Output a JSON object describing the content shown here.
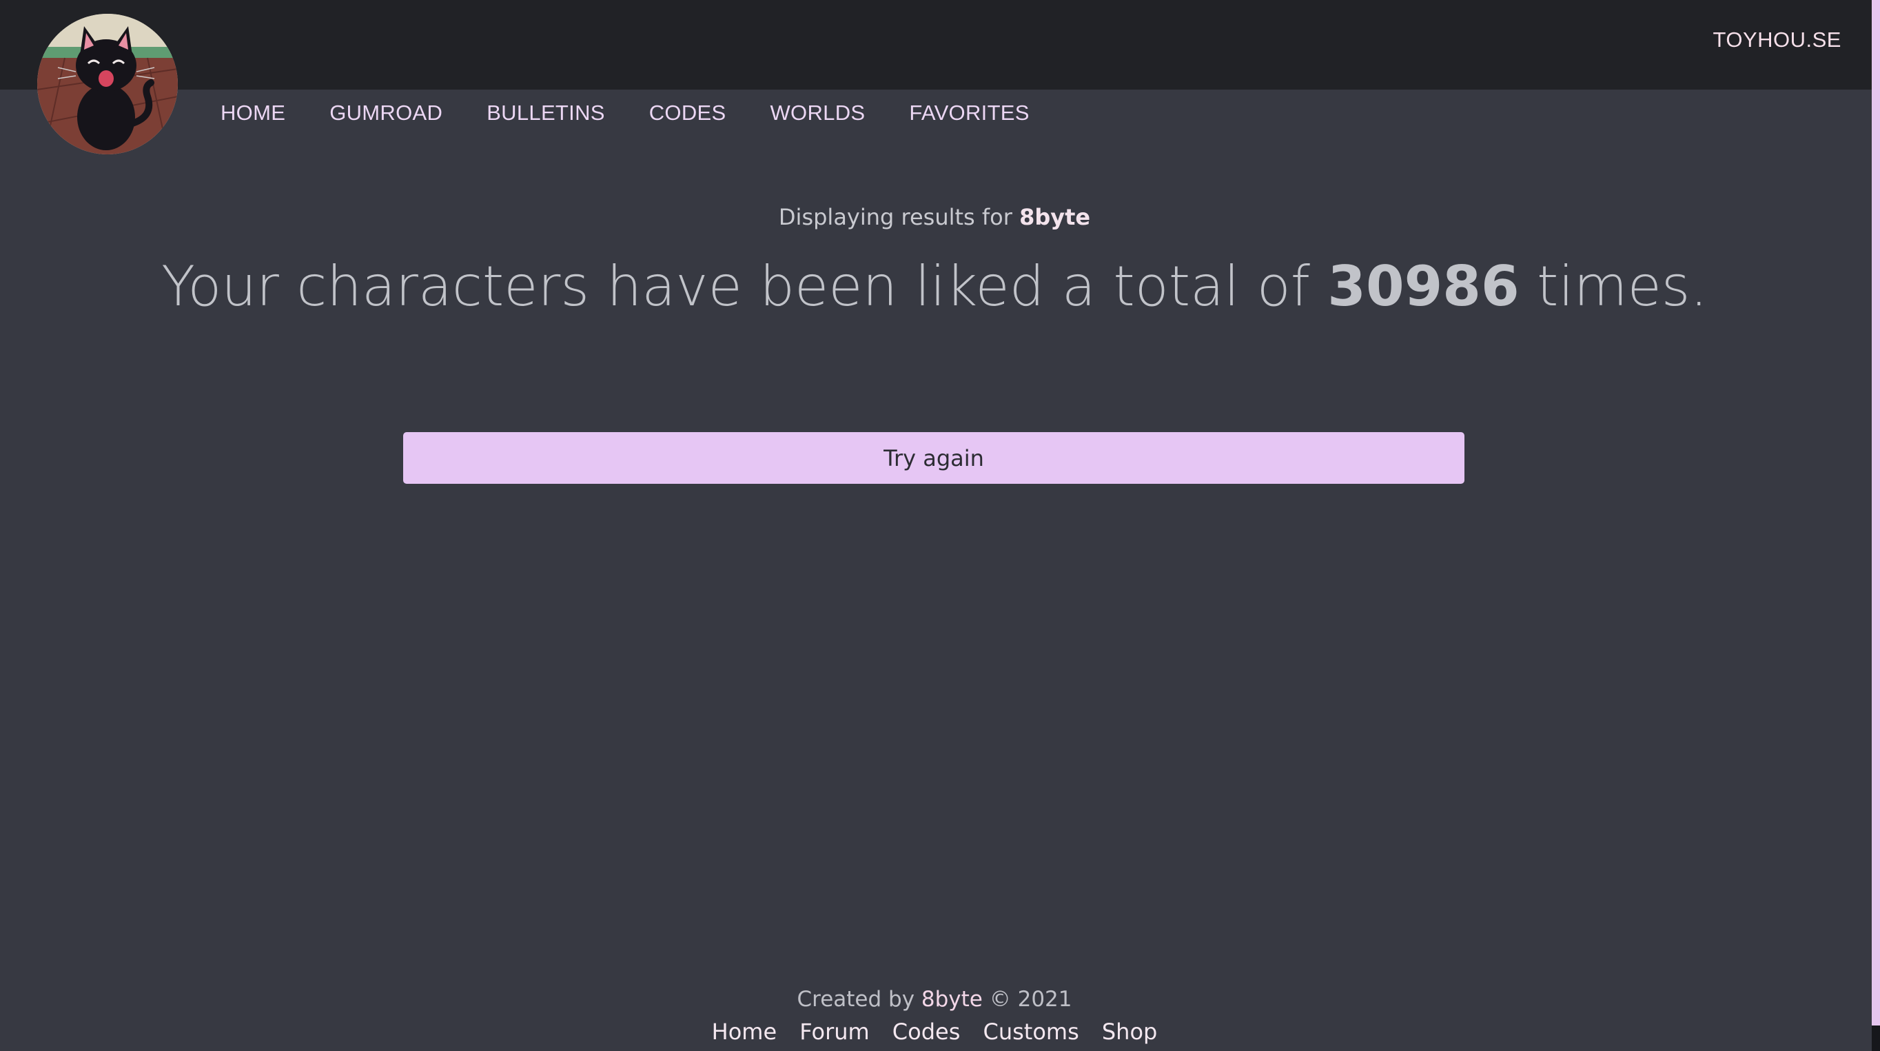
{
  "header": {
    "site_link": "TOYHOU.SE",
    "avatar_icon": "black-cat-avatar-icon"
  },
  "nav": {
    "items": [
      {
        "label": "HOME"
      },
      {
        "label": "GUMROAD"
      },
      {
        "label": "BULLETINS"
      },
      {
        "label": "CODES"
      },
      {
        "label": "WORLDS"
      },
      {
        "label": "FAVORITES"
      }
    ]
  },
  "main": {
    "subtitle_prefix": "Displaying results for ",
    "username": "8byte",
    "headline_part1": "Your characters have been liked a total of ",
    "like_count": "30986",
    "headline_part2": " times.",
    "try_again_label": "Try again"
  },
  "footer": {
    "created_by_prefix": "Created by ",
    "author": "8byte",
    "copyright": " © 2021",
    "links": [
      {
        "label": "Home"
      },
      {
        "label": "Forum"
      },
      {
        "label": "Codes"
      },
      {
        "label": "Customs"
      },
      {
        "label": "Shop"
      }
    ]
  },
  "colors": {
    "background": "#373942",
    "topbar": "#212226",
    "accent": "#e6c6f4",
    "nav_text": "#ecd7f4"
  }
}
